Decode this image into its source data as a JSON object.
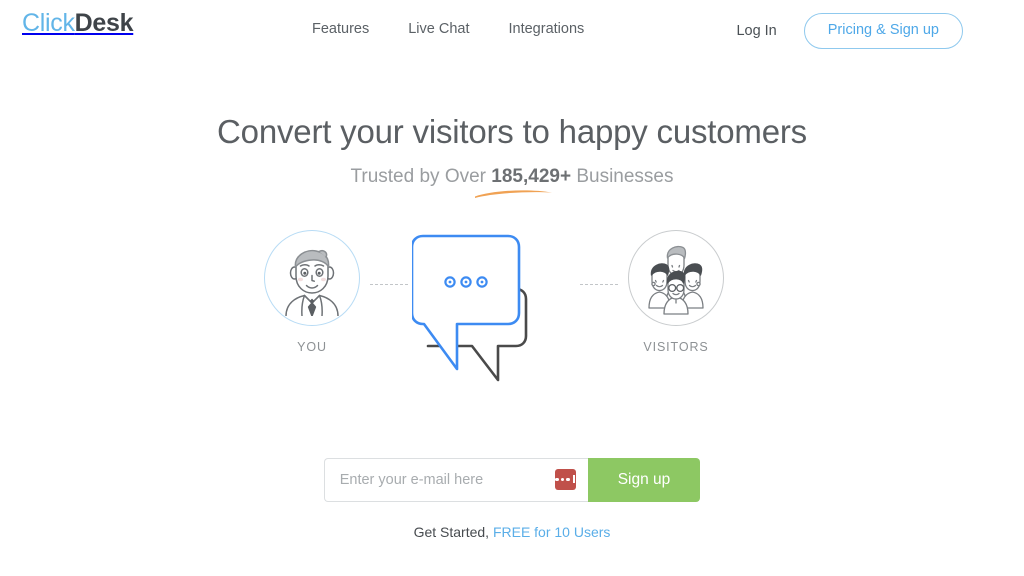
{
  "brand": {
    "name_part1": "Click",
    "name_part2": "Desk",
    "accent_blue": "#62b5e8",
    "dark": "#3f4449"
  },
  "nav": {
    "items": [
      {
        "label": "Features"
      },
      {
        "label": "Live Chat"
      },
      {
        "label": "Integrations"
      }
    ],
    "login_label": "Log In",
    "pricing_label": "Pricing & Sign up"
  },
  "hero": {
    "headline": "Convert your visitors to happy customers",
    "sub_prefix": "Trusted by Over ",
    "sub_count": "185,429+",
    "sub_suffix": " Businesses",
    "underline_color": "#ef9a45"
  },
  "illustration": {
    "you_label": "YOU",
    "visitors_label": "VISITORS",
    "bubble_front_color": "#3d8bf2",
    "bubble_back_color": "#4a4a4a",
    "typing_dots": 3
  },
  "form": {
    "email_placeholder": "Enter your e-mail here",
    "email_value": "",
    "password_manager_icon": "lastpass-icon",
    "signup_label": "Sign up",
    "button_color": "#8dc863"
  },
  "footer_cta": {
    "prefix": "Get Started, ",
    "link_label": "FREE for 10 Users"
  }
}
